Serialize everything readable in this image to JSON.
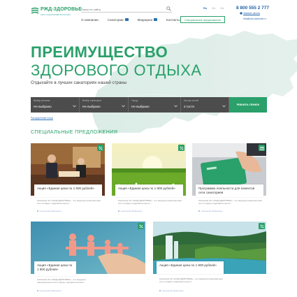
{
  "header": {
    "logo_text": "РЖД-ЗДОРОВЬЕ",
    "logo_subtitle": "СЕТЬ САНАТОРИЕВ В РОССИИ",
    "search_placeholder": "Поиск по сайту",
    "languages": [
      "Ru",
      "En",
      "De"
    ],
    "active_language": "Ru",
    "phone": "8 800 555 2 777",
    "callback_label": "Заказать звонок",
    "email": "info@rzd-zdorovie.ru",
    "nav": [
      {
        "label": "О компании",
        "has_icon": false
      },
      {
        "label": "Санатории",
        "has_icon": true
      },
      {
        "label": "Медицина",
        "has_icon": true
      },
      {
        "label": "Контакты",
        "has_icon": false
      }
    ],
    "special_offers_button": "Специальные предложения"
  },
  "hero": {
    "title_line1": "ПРЕИМУЩЕСТВО",
    "title_line2": "ЗДОРОВОГО ОТДЫХА",
    "subtitle": "Отдыхайте в лучших санаториях нашей страны",
    "form": {
      "fields": [
        {
          "label": "Выбор региона",
          "value": "Не выбрано"
        },
        {
          "label": "Выбор санатория",
          "value": "Не выбрано"
        },
        {
          "label": "Город",
          "value": "Не выбрано"
        },
        {
          "label": "Кол-во гостей",
          "value": "2 гостя"
        }
      ],
      "submit_label": "Начать поиск"
    },
    "expanded_search_link": "Расширенный поиск"
  },
  "offers": {
    "title": "СПЕЦИАЛЬНЫЕ ПРЕДЛОЖЕНИЯ",
    "cards": [
      {
        "title": "Акция «Единая цена по 1 900 рублей»",
        "desc": "Компания АО «РЖД-ЗДОРОВЬЕ» - это ведущая национальная сеть в сфере оздоровительного...",
        "location": "Санаторий Любашкино",
        "badge": "percent"
      },
      {
        "title": "Акция «Единая цена по 1 900 рублей»",
        "desc": "Компания АО «РЖД-ЗДОРОВЬЕ» - это ведущая национальная сеть в сфере оздоровительного...",
        "location": "Санаторий Любашкино",
        "badge": "percent"
      },
      {
        "title": "Программа лояльности для клиентов сети санаториев",
        "desc": "Компания АО «РЖД-ЗДОРОВЬЕ» - это ведущая национальная сеть в сфере оздоровительного...",
        "location": "Санаторий Любашкино",
        "badge": "gift"
      },
      {
        "title": "Акция «Единая цена по 1 900 рублей»",
        "desc": "Компания АО «РЖД-ЗДОРОВЬЕ» - это ведущая национальная сеть в сфере оздоровительного...",
        "location": "Санаторий Любашкино",
        "badge": "percent"
      },
      {
        "title": "Акция «Единая цена по 1 900 рублей»",
        "desc": "Компания АО «РЖД-ЗДОРОВЬЕ» - это ведущая национальная сеть в сфере оздоровительного...",
        "location": "Санаторий Любашкино",
        "badge": "percent"
      }
    ]
  },
  "colors": {
    "brand_green": "#2aa06a",
    "brand_blue": "#1d5fa8",
    "form_bg": "#4c4c4c"
  }
}
